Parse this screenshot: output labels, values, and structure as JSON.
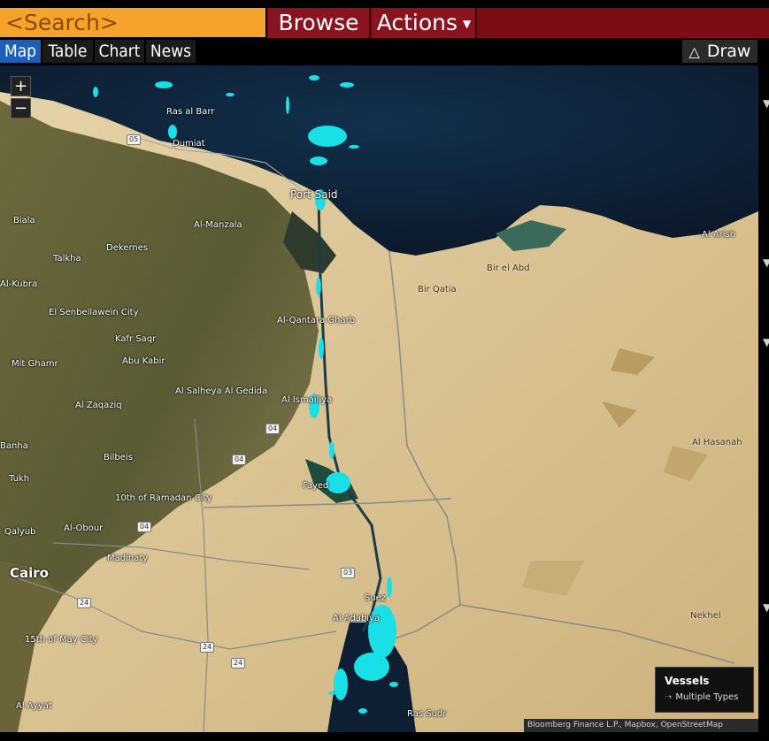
{
  "toolbar": {
    "search_placeholder": "<Search>",
    "browse_label": "Browse",
    "actions_label": "Actions"
  },
  "tabs": [
    {
      "label": "Map",
      "active": true
    },
    {
      "label": "Table",
      "active": false
    },
    {
      "label": "Chart",
      "active": false
    },
    {
      "label": "News",
      "active": false
    }
  ],
  "draw_label": "Draw",
  "map": {
    "zoom_in": "+",
    "zoom_out": "−",
    "places": [
      "Ras al Barr",
      "Dumiat",
      "Port Said",
      "Al-Manzala",
      "Biala",
      "Dekernes",
      "Talkha",
      "Al-Kubra",
      "El Senbellawein City",
      "Kafr Saqr",
      "Mit Ghamr",
      "Abu Kabir",
      "Al-Qantara Gharb",
      "Al Salheya Al Gedida",
      "Al Ismailiya",
      "Al Zaqaziq",
      "Banha",
      "Bilbeis",
      "Tukh",
      "Fayed",
      "10th of Ramadan City",
      "Qalyub",
      "Al-Obour",
      "Madinaty",
      "Cairo",
      "15th of May City",
      "Al Ayyat",
      "Al Adabiya",
      "Suez",
      "Ras Sudr",
      "Bir el Abd",
      "Bir Qatia",
      "Al Arish",
      "Al Hasanah",
      "Nekhel"
    ],
    "roads": [
      "05",
      "04",
      "04",
      "04",
      "03",
      "24",
      "24",
      "24"
    ]
  },
  "legend": {
    "title": "Vessels",
    "item": "Multiple Types",
    "vessel_color": "#19e0e6"
  },
  "attribution": "Bloomberg Finance L.P., Mapbox, OpenStreetMap",
  "colors": {
    "search_bg": "#f6a32b",
    "command_bar": "#7c0d16",
    "active_tab": "#1d5fb8",
    "sea": "#0e1e33",
    "desert": "#d9c497",
    "delta": "#5c5a33"
  }
}
